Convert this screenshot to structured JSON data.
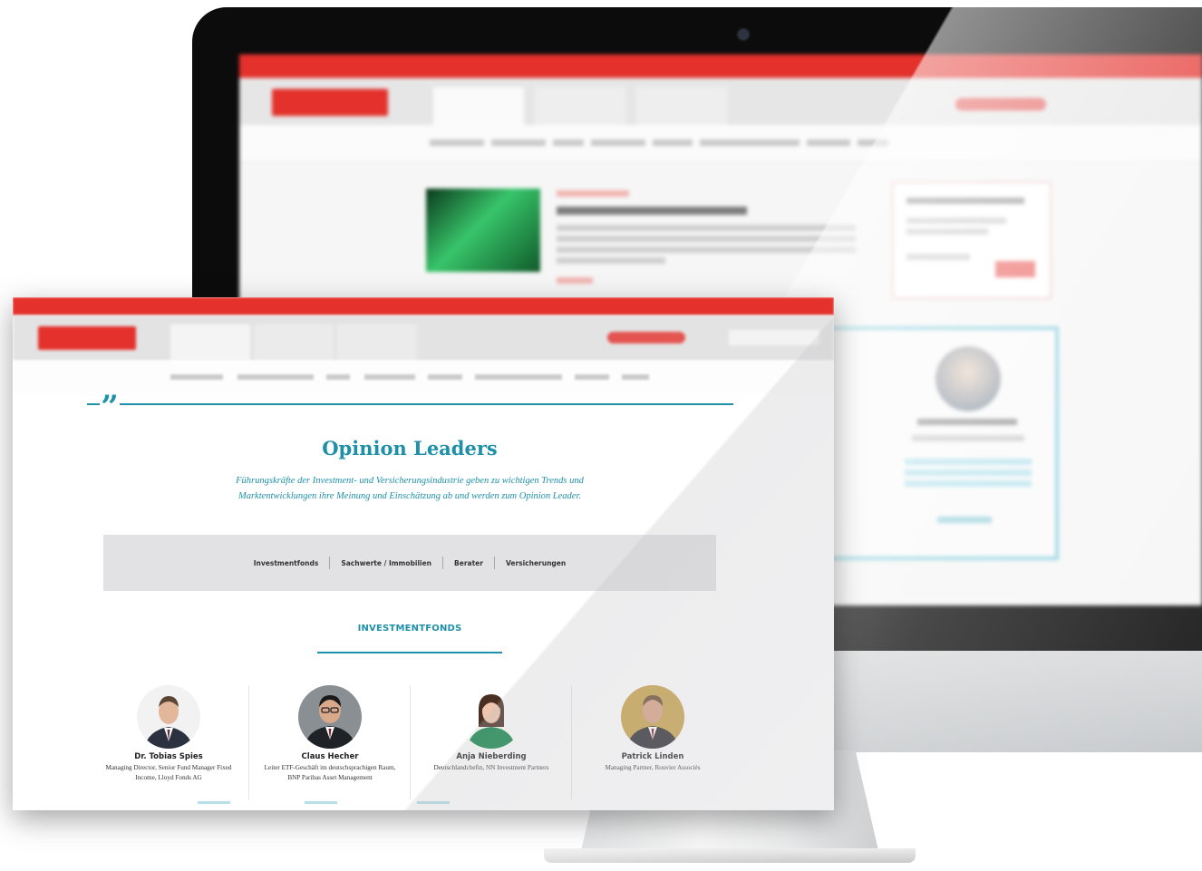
{
  "page": {
    "title": "Opinion Leaders",
    "subtitle": "Führungskräfte der Investment- und Versicherungsindustrie geben zu wichtigen Trends und Marktentwicklungen ihre Meinung und Einschätzung ab und werden zum Opinion Leader."
  },
  "filters": [
    {
      "label": "Investmentfonds"
    },
    {
      "label": "Sachwerte / Immobilien"
    },
    {
      "label": "Berater"
    },
    {
      "label": "Versicherungen"
    }
  ],
  "section": {
    "heading": "INVESTMENTFONDS"
  },
  "people": [
    {
      "name": "Dr. Tobias Spies",
      "role": "Managing Director, Senior Fund Manager Fixed Income, Lloyd Fonds AG"
    },
    {
      "name": "Claus Hecher",
      "role": "Leiter ETF-Geschäft im deutschsprachigen Raum, BNP Paribas Asset Management"
    },
    {
      "name": "Anja Nieberding",
      "role": "Deutschlandchefin, NN Investment Partners"
    },
    {
      "name": "Patrick Linden",
      "role": "Managing Partner, Rouvier Associés"
    }
  ],
  "icons": {
    "quote": "quote-icon",
    "webcam": "camera-icon"
  },
  "colors": {
    "accent": "#1e90a8",
    "brand_red": "#e4312c",
    "filter_bg": "#e2e2e4"
  }
}
